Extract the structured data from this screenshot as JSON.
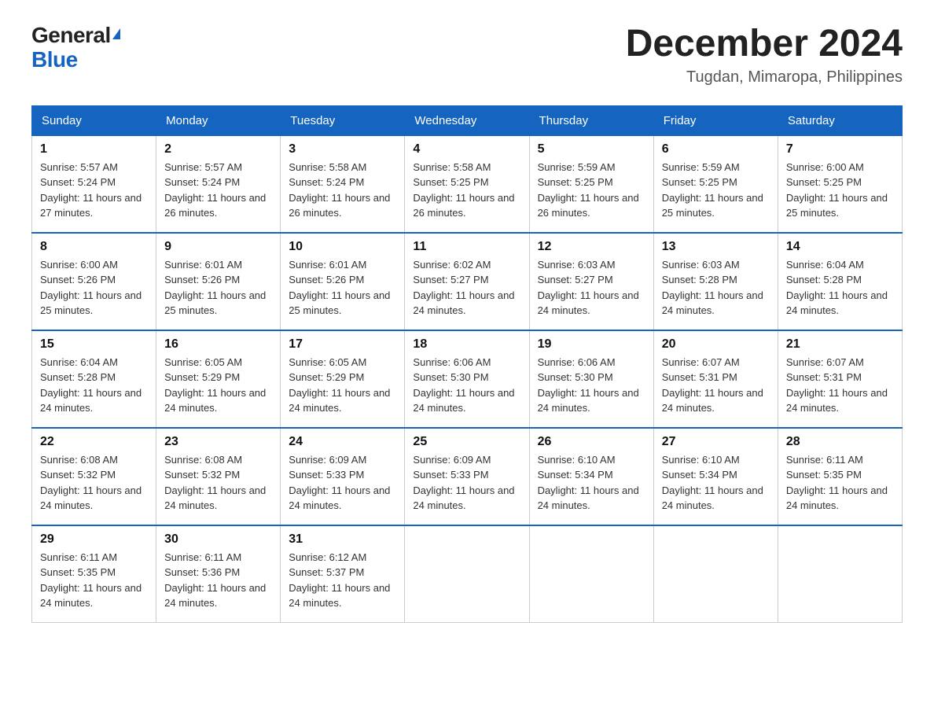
{
  "header": {
    "logo_general": "General",
    "logo_blue": "Blue",
    "month_title": "December 2024",
    "location": "Tugdan, Mimaropa, Philippines"
  },
  "weekdays": [
    "Sunday",
    "Monday",
    "Tuesday",
    "Wednesday",
    "Thursday",
    "Friday",
    "Saturday"
  ],
  "weeks": [
    [
      {
        "day": "1",
        "sunrise": "Sunrise: 5:57 AM",
        "sunset": "Sunset: 5:24 PM",
        "daylight": "Daylight: 11 hours and 27 minutes."
      },
      {
        "day": "2",
        "sunrise": "Sunrise: 5:57 AM",
        "sunset": "Sunset: 5:24 PM",
        "daylight": "Daylight: 11 hours and 26 minutes."
      },
      {
        "day": "3",
        "sunrise": "Sunrise: 5:58 AM",
        "sunset": "Sunset: 5:24 PM",
        "daylight": "Daylight: 11 hours and 26 minutes."
      },
      {
        "day": "4",
        "sunrise": "Sunrise: 5:58 AM",
        "sunset": "Sunset: 5:25 PM",
        "daylight": "Daylight: 11 hours and 26 minutes."
      },
      {
        "day": "5",
        "sunrise": "Sunrise: 5:59 AM",
        "sunset": "Sunset: 5:25 PM",
        "daylight": "Daylight: 11 hours and 26 minutes."
      },
      {
        "day": "6",
        "sunrise": "Sunrise: 5:59 AM",
        "sunset": "Sunset: 5:25 PM",
        "daylight": "Daylight: 11 hours and 25 minutes."
      },
      {
        "day": "7",
        "sunrise": "Sunrise: 6:00 AM",
        "sunset": "Sunset: 5:25 PM",
        "daylight": "Daylight: 11 hours and 25 minutes."
      }
    ],
    [
      {
        "day": "8",
        "sunrise": "Sunrise: 6:00 AM",
        "sunset": "Sunset: 5:26 PM",
        "daylight": "Daylight: 11 hours and 25 minutes."
      },
      {
        "day": "9",
        "sunrise": "Sunrise: 6:01 AM",
        "sunset": "Sunset: 5:26 PM",
        "daylight": "Daylight: 11 hours and 25 minutes."
      },
      {
        "day": "10",
        "sunrise": "Sunrise: 6:01 AM",
        "sunset": "Sunset: 5:26 PM",
        "daylight": "Daylight: 11 hours and 25 minutes."
      },
      {
        "day": "11",
        "sunrise": "Sunrise: 6:02 AM",
        "sunset": "Sunset: 5:27 PM",
        "daylight": "Daylight: 11 hours and 24 minutes."
      },
      {
        "day": "12",
        "sunrise": "Sunrise: 6:03 AM",
        "sunset": "Sunset: 5:27 PM",
        "daylight": "Daylight: 11 hours and 24 minutes."
      },
      {
        "day": "13",
        "sunrise": "Sunrise: 6:03 AM",
        "sunset": "Sunset: 5:28 PM",
        "daylight": "Daylight: 11 hours and 24 minutes."
      },
      {
        "day": "14",
        "sunrise": "Sunrise: 6:04 AM",
        "sunset": "Sunset: 5:28 PM",
        "daylight": "Daylight: 11 hours and 24 minutes."
      }
    ],
    [
      {
        "day": "15",
        "sunrise": "Sunrise: 6:04 AM",
        "sunset": "Sunset: 5:28 PM",
        "daylight": "Daylight: 11 hours and 24 minutes."
      },
      {
        "day": "16",
        "sunrise": "Sunrise: 6:05 AM",
        "sunset": "Sunset: 5:29 PM",
        "daylight": "Daylight: 11 hours and 24 minutes."
      },
      {
        "day": "17",
        "sunrise": "Sunrise: 6:05 AM",
        "sunset": "Sunset: 5:29 PM",
        "daylight": "Daylight: 11 hours and 24 minutes."
      },
      {
        "day": "18",
        "sunrise": "Sunrise: 6:06 AM",
        "sunset": "Sunset: 5:30 PM",
        "daylight": "Daylight: 11 hours and 24 minutes."
      },
      {
        "day": "19",
        "sunrise": "Sunrise: 6:06 AM",
        "sunset": "Sunset: 5:30 PM",
        "daylight": "Daylight: 11 hours and 24 minutes."
      },
      {
        "day": "20",
        "sunrise": "Sunrise: 6:07 AM",
        "sunset": "Sunset: 5:31 PM",
        "daylight": "Daylight: 11 hours and 24 minutes."
      },
      {
        "day": "21",
        "sunrise": "Sunrise: 6:07 AM",
        "sunset": "Sunset: 5:31 PM",
        "daylight": "Daylight: 11 hours and 24 minutes."
      }
    ],
    [
      {
        "day": "22",
        "sunrise": "Sunrise: 6:08 AM",
        "sunset": "Sunset: 5:32 PM",
        "daylight": "Daylight: 11 hours and 24 minutes."
      },
      {
        "day": "23",
        "sunrise": "Sunrise: 6:08 AM",
        "sunset": "Sunset: 5:32 PM",
        "daylight": "Daylight: 11 hours and 24 minutes."
      },
      {
        "day": "24",
        "sunrise": "Sunrise: 6:09 AM",
        "sunset": "Sunset: 5:33 PM",
        "daylight": "Daylight: 11 hours and 24 minutes."
      },
      {
        "day": "25",
        "sunrise": "Sunrise: 6:09 AM",
        "sunset": "Sunset: 5:33 PM",
        "daylight": "Daylight: 11 hours and 24 minutes."
      },
      {
        "day": "26",
        "sunrise": "Sunrise: 6:10 AM",
        "sunset": "Sunset: 5:34 PM",
        "daylight": "Daylight: 11 hours and 24 minutes."
      },
      {
        "day": "27",
        "sunrise": "Sunrise: 6:10 AM",
        "sunset": "Sunset: 5:34 PM",
        "daylight": "Daylight: 11 hours and 24 minutes."
      },
      {
        "day": "28",
        "sunrise": "Sunrise: 6:11 AM",
        "sunset": "Sunset: 5:35 PM",
        "daylight": "Daylight: 11 hours and 24 minutes."
      }
    ],
    [
      {
        "day": "29",
        "sunrise": "Sunrise: 6:11 AM",
        "sunset": "Sunset: 5:35 PM",
        "daylight": "Daylight: 11 hours and 24 minutes."
      },
      {
        "day": "30",
        "sunrise": "Sunrise: 6:11 AM",
        "sunset": "Sunset: 5:36 PM",
        "daylight": "Daylight: 11 hours and 24 minutes."
      },
      {
        "day": "31",
        "sunrise": "Sunrise: 6:12 AM",
        "sunset": "Sunset: 5:37 PM",
        "daylight": "Daylight: 11 hours and 24 minutes."
      },
      null,
      null,
      null,
      null
    ]
  ]
}
